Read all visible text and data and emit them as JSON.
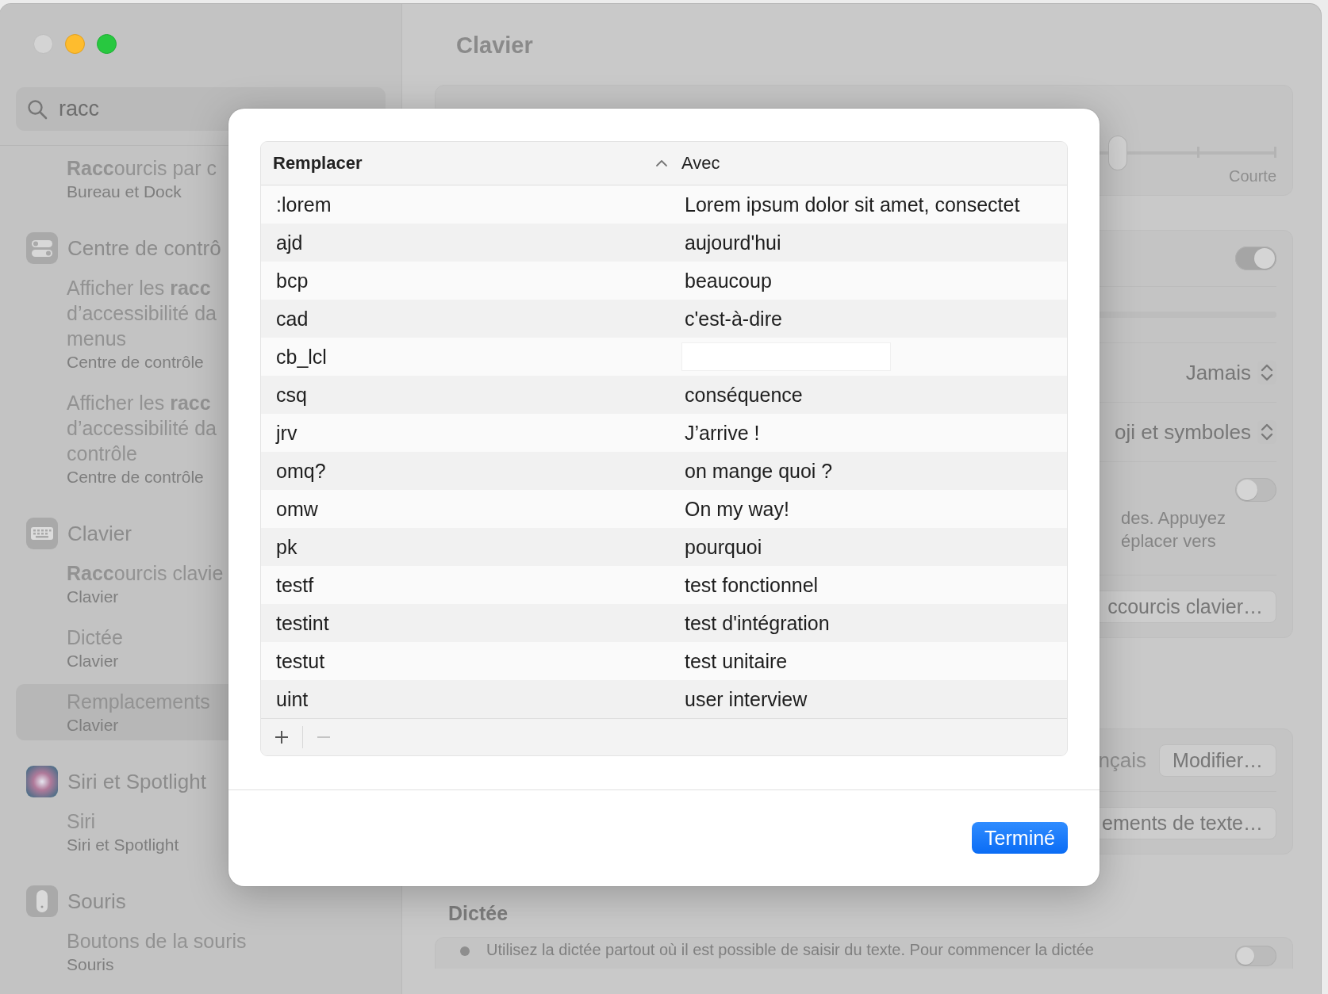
{
  "window": {
    "controls": [
      {
        "kind": "close",
        "color": "#d4d4d4"
      },
      {
        "kind": "minimize",
        "color": "#febc2e"
      },
      {
        "kind": "zoom",
        "color": "#28c840"
      }
    ]
  },
  "sidebar": {
    "search": {
      "value": "racc"
    },
    "groups": [
      {
        "items": [
          {
            "title": "**Racc**ourcis par c",
            "subtitle": "Bureau et Dock",
            "selected": false
          }
        ]
      },
      {
        "title": "Centre de contrô",
        "kind": "toggles",
        "items": [
          {
            "title": "Afficher les **racc**\nd’accessibilité da\nmenus",
            "subtitle": "Centre de contrôle",
            "selected": false
          },
          {
            "title": "Afficher les **racc**\nd’accessibilité da\ncontrôle",
            "subtitle": "Centre de contrôle",
            "selected": false
          }
        ]
      },
      {
        "title": "Clavier",
        "kind": "keyboard",
        "items": [
          {
            "title": "**Racc**ourcis clavie",
            "subtitle": "Clavier",
            "selected": false
          },
          {
            "title": "Dictée",
            "subtitle": "Clavier",
            "selected": false
          },
          {
            "title": "Remplacements",
            "subtitle": "Clavier",
            "selected": true
          }
        ]
      },
      {
        "title": "Siri et Spotlight",
        "kind": "siri",
        "items": [
          {
            "title": "Siri",
            "subtitle": "Siri et Spotlight",
            "selected": false
          }
        ]
      },
      {
        "title": "Souris",
        "kind": "mouse",
        "items": [
          {
            "title": "Boutons de la souris",
            "subtitle": "Souris",
            "selected": false
          }
        ]
      }
    ]
  },
  "content": {
    "title": "Clavier",
    "cards": [
      {
        "rows": [
          {
            "kind": "slider",
            "level": 0.6,
            "label": "Courte"
          }
        ]
      },
      {
        "rows": [
          {
            "kind": "toggle",
            "on": true
          },
          {
            "kind": "track"
          },
          {
            "kind": "popup",
            "value": "Jamais"
          },
          {
            "kind": "popup",
            "value": "oji et symboles"
          },
          {
            "kind": "toggle",
            "on": false,
            "note": "des. Appuyez\néplacer vers"
          },
          {
            "kind": "button",
            "label": "ccourcis clavier…"
          }
        ]
      },
      {
        "rows": [
          {
            "kind": "button",
            "text": "nçais",
            "label": "Modifier…"
          },
          {
            "kind": "button",
            "label": "ements de texte…"
          }
        ]
      }
    ],
    "dictation": {
      "heading": "Dictée",
      "text": "Utilisez la dictée partout où il est possible de saisir du texte. Pour commencer la dictée",
      "on": false
    }
  },
  "dialog": {
    "columns": [
      {
        "label": "Remplacer",
        "sorted": true
      },
      {
        "label": "Avec",
        "sorted": false
      }
    ],
    "rows": [
      {
        "replace": ":lorem",
        "with": "Lorem ipsum dolor sit amet, consectet",
        "editing": false
      },
      {
        "replace": "ajd",
        "with": "aujourd'hui",
        "editing": false
      },
      {
        "replace": "bcp",
        "with": "beaucoup",
        "editing": false
      },
      {
        "replace": "cad",
        "with": "c'est-à-dire",
        "editing": false
      },
      {
        "replace": "cb_lcl",
        "editing": true
      },
      {
        "replace": "csq",
        "with": "conséquence",
        "editing": false
      },
      {
        "replace": "jrv",
        "with": "J’arrive !",
        "editing": false
      },
      {
        "replace": "omq?",
        "with": "on mange quoi ?",
        "editing": false
      },
      {
        "replace": "omw",
        "with": "On my way!",
        "editing": false
      },
      {
        "replace": "pk",
        "with": "pourquoi",
        "editing": false
      },
      {
        "replace": "testf",
        "with": "test fonctionnel",
        "editing": false
      },
      {
        "replace": "testint",
        "with": "test d'intégration",
        "editing": false
      },
      {
        "replace": "testut",
        "with": "test unitaire",
        "editing": false
      },
      {
        "replace": "uint",
        "with": "user interview",
        "editing": false
      }
    ],
    "remove_enabled": false,
    "done": "Terminé"
  }
}
